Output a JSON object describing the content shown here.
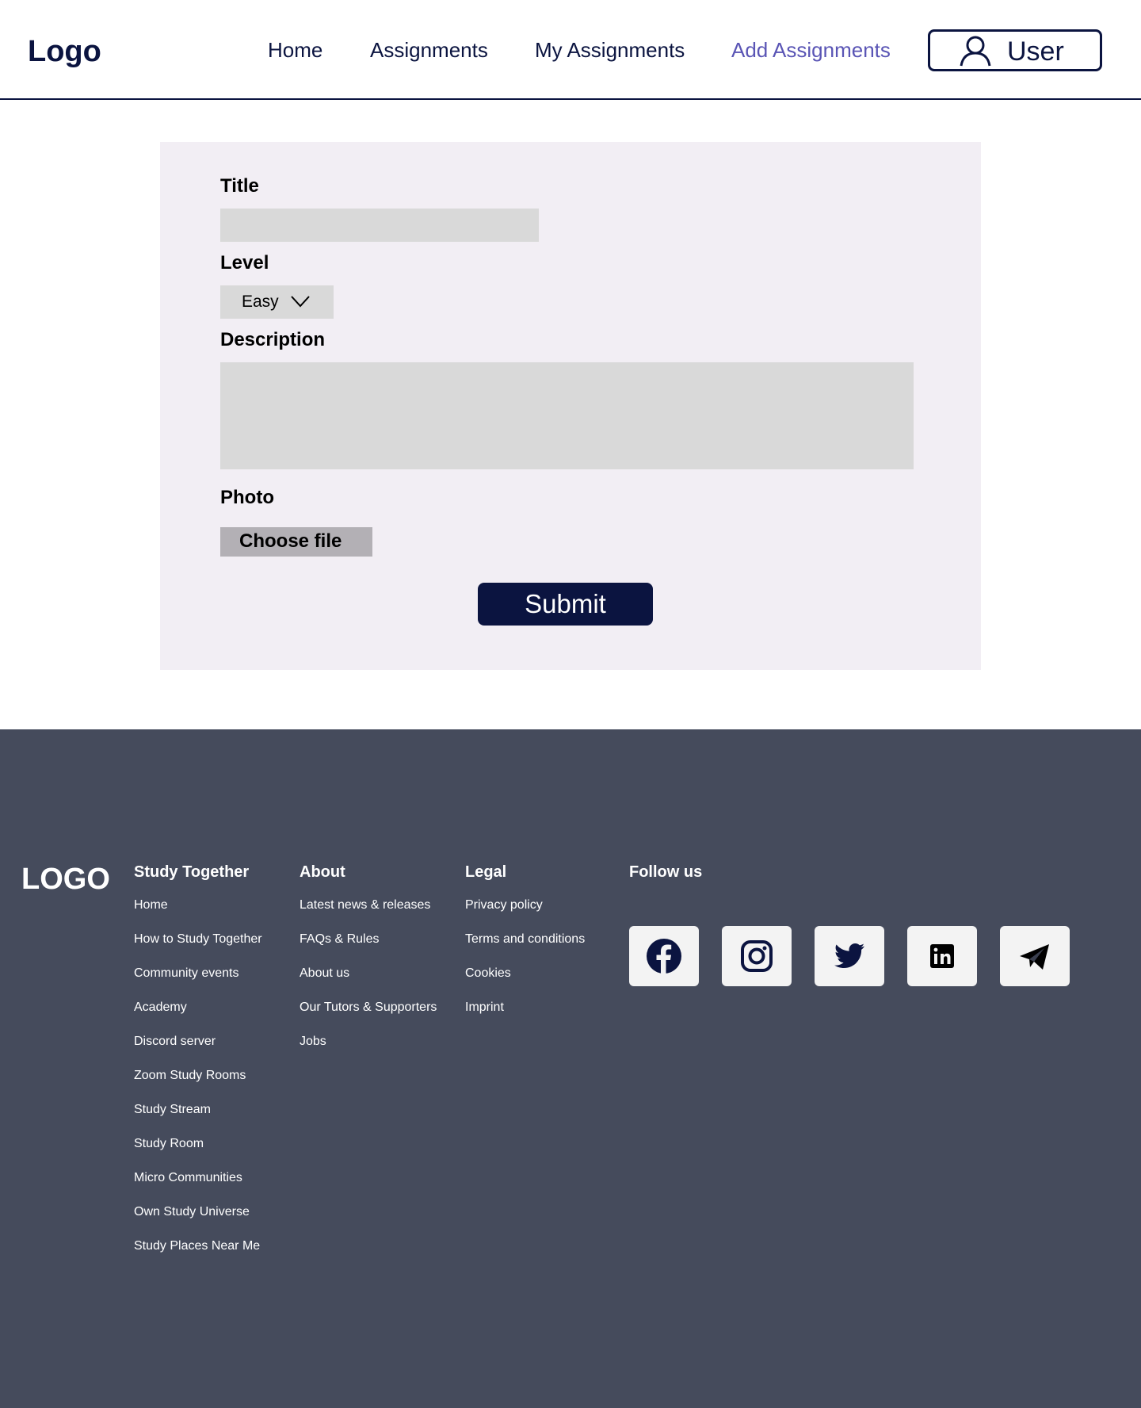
{
  "header": {
    "logo": "Logo",
    "nav": [
      {
        "label": "Home",
        "active": false
      },
      {
        "label": "Assignments",
        "active": false
      },
      {
        "label": "My Assignments",
        "active": false
      },
      {
        "label": "Add Assignments",
        "active": true
      }
    ],
    "user_label": "User",
    "user_icon": "user-icon"
  },
  "form": {
    "title_label": "Title",
    "title_value": "",
    "level_label": "Level",
    "level_value": "Easy",
    "description_label": "Description",
    "description_value": "",
    "photo_label": "Photo",
    "choose_file_label": "Choose file",
    "submit_label": "Submit"
  },
  "footer": {
    "logo": "LOGO",
    "columns": [
      {
        "heading": "Study Together",
        "items": [
          "Home",
          "How to Study Together",
          "Community events",
          "Academy",
          "Discord server",
          "Zoom Study Rooms",
          "Study Stream",
          "Study Room",
          "Micro Communities",
          "Own Study Universe",
          "Study Places Near Me"
        ]
      },
      {
        "heading": "About",
        "items": [
          "Latest news & releases",
          "FAQs & Rules",
          "About us",
          "Our Tutors & Supporters",
          "Jobs"
        ]
      },
      {
        "heading": "Legal",
        "items": [
          "Privacy policy",
          "Terms and conditions",
          "Cookies",
          "Imprint"
        ]
      }
    ],
    "follow_heading": "Follow us",
    "socials": [
      "facebook-icon",
      "instagram-icon",
      "twitter-icon",
      "linkedin-icon",
      "telegram-icon"
    ]
  },
  "colors": {
    "primary_navy": "#0b1440",
    "active_nav": "#5a55b5",
    "card_bg": "#f2eef4",
    "input_bg": "#d9d9d9",
    "footer_bg": "#454b5c"
  }
}
